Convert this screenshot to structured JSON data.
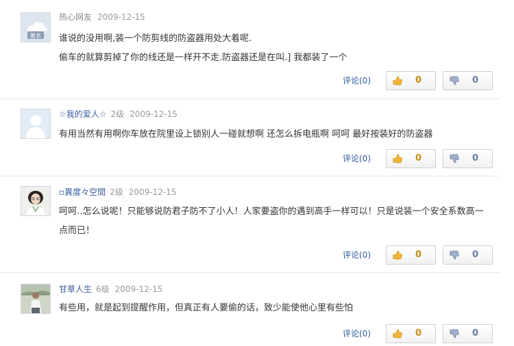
{
  "answers": [
    {
      "user": "热心网友",
      "level": "",
      "date": "2009-12-15",
      "avatar": "anonymous-avatar",
      "avatar_label": "匿名",
      "paragraphs": [
        "谁说的没用啊,装一个防剪线的防盗器用处大着呢.",
        "偷车的就算剪掉了你的线还是一样开不走.防盗器还是在叫.] 我都装了一个"
      ],
      "comment_label": "评论(0)",
      "up_count": "0",
      "down_count": "0"
    },
    {
      "user": "☆我的爱人☆",
      "level": "2级",
      "date": "2009-12-15",
      "avatar": "default-avatar",
      "paragraphs": [
        "有用当然有用啊你车放在院里设上锁别人一碰就想啊 还怎么拆电瓶啊 呵呵 最好按装好的防盗器"
      ],
      "comment_label": "评论(0)",
      "up_count": "0",
      "down_count": "0"
    },
    {
      "user": "▫異度々空間",
      "level": "2级",
      "date": "2009-12-15",
      "avatar": "photo-avatar-woman",
      "paragraphs": [
        "呵呵‥怎么说呢！只能够说防君子防不了小人！人家要盗你的遇到高手一样可以！只是说装一个安全系数高一点而已！"
      ],
      "comment_label": "评论(0)",
      "up_count": "0",
      "down_count": "0"
    },
    {
      "user": "甘草人生",
      "level": "6级",
      "date": "2009-12-15",
      "avatar": "photo-avatar-man",
      "paragraphs": [
        "有些用，就是起到提醒作用，但真正有人要偷的话，致少能使他心里有些怕"
      ],
      "comment_label": "评论(0)",
      "up_count": "0",
      "down_count": "0"
    }
  ],
  "icons": {
    "thumbs_up": "thumbs-up-icon",
    "thumbs_down": "thumbs-down-icon"
  },
  "colors": {
    "username": "#3a5d9c",
    "comment_link": "#2b5a9c",
    "up_count": "#c88a12",
    "down_count": "#6a7ea0"
  }
}
